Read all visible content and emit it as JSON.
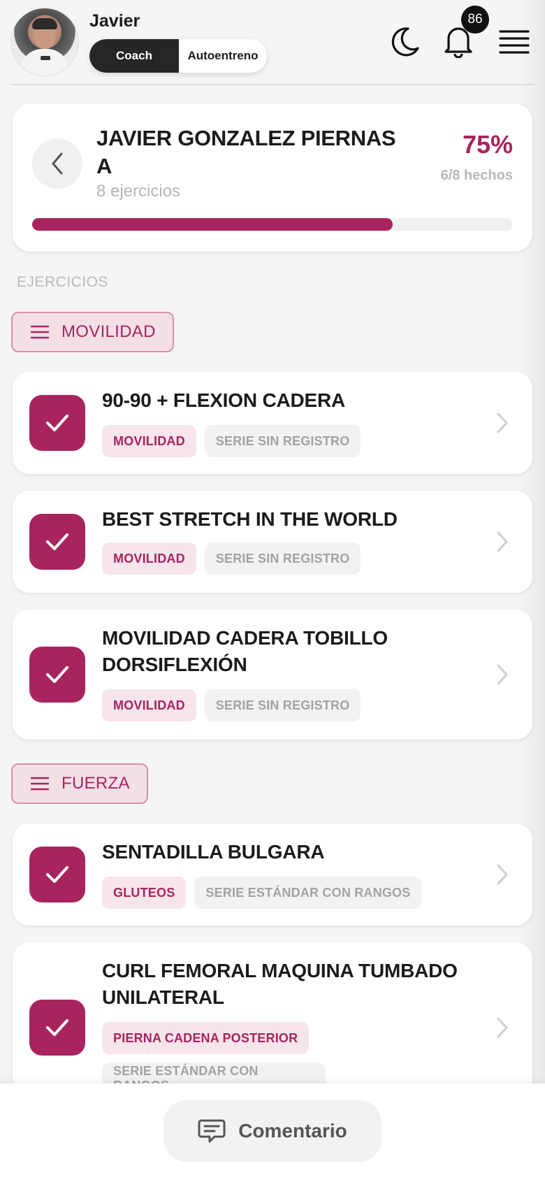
{
  "header": {
    "user_name": "Javier",
    "modes": [
      {
        "label": "Coach",
        "active": true
      },
      {
        "label": "Autoentreno",
        "active": false
      }
    ],
    "notifications_count": "86",
    "icons": [
      "moon-icon",
      "bell-icon",
      "hamburger-menu-icon"
    ]
  },
  "summary": {
    "title": "JAVIER GONZALEZ PIERNAS A",
    "count_label": "8 ejercicios",
    "percent_label": "75%",
    "done_label": "6/8 hechos",
    "progress": 0.75
  },
  "section_label": "EJERCICIOS",
  "categories": [
    {
      "name": "MOVILIDAD",
      "exercises": [
        {
          "title": "90-90 + FLEXION CADERA",
          "done": true,
          "tags": [
            "MOVILIDAD",
            "SERIE SIN REGISTRO"
          ]
        },
        {
          "title": "BEST STRETCH IN THE WORLD",
          "done": true,
          "tags": [
            "MOVILIDAD",
            "SERIE SIN REGISTRO"
          ]
        },
        {
          "title": "MOVILIDAD CADERA TOBILLO DORSIFLEXIÓN",
          "done": true,
          "tags": [
            "MOVILIDAD",
            "SERIE SIN REGISTRO"
          ]
        }
      ]
    },
    {
      "name": "FUERZA",
      "exercises": [
        {
          "title": "SENTADILLA BULGARA",
          "done": true,
          "tags": [
            "GLUTEOS",
            "SERIE ESTÁNDAR CON RANGOS"
          ]
        },
        {
          "title": "CURL FEMORAL MAQUINA TUMBADO UNILATERAL",
          "done": true,
          "tags": [
            "PIERNA CADENA POSTERIOR",
            "SERIE ESTÁNDAR CON RANGOS"
          ]
        }
      ]
    }
  ],
  "comment_button": "Comentario",
  "colors": {
    "accent": "#a8245e",
    "accent_soft": "#f7e5ec",
    "dark": "#262626",
    "tag_grey": "#f2f2f2"
  }
}
